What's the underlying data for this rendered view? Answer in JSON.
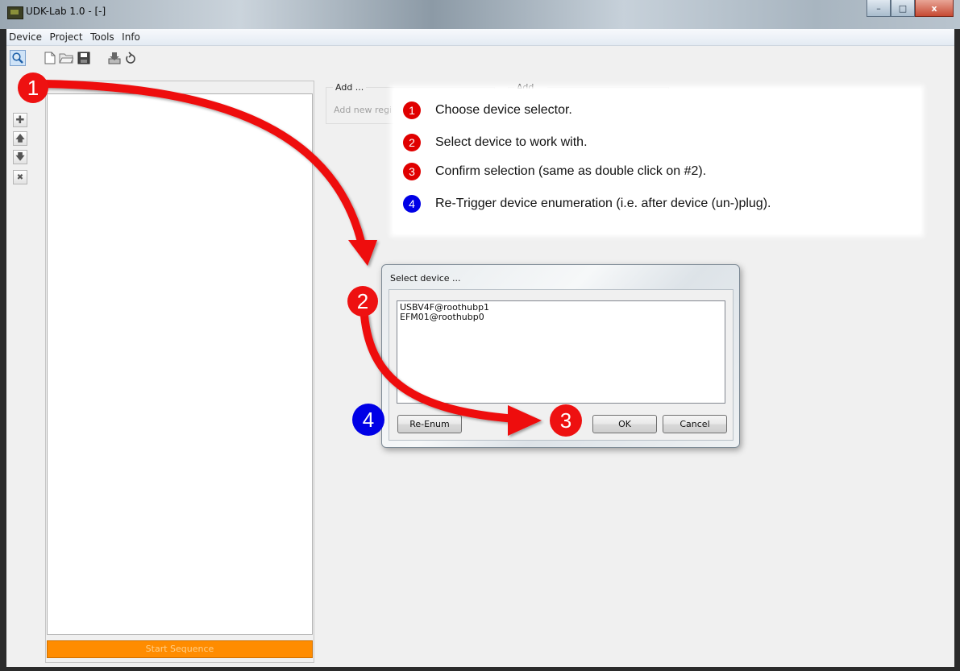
{
  "window": {
    "title": "UDK-Lab 1.0 - [-]",
    "minimize": "–",
    "maximize": "□",
    "close": "x"
  },
  "menu": [
    "Device",
    "Project",
    "Tools",
    "Info"
  ],
  "toolbar_icons": [
    "search-icon",
    "new-file-icon",
    "open-folder-icon",
    "save-icon",
    "download-icon",
    "refresh-icon"
  ],
  "side_buttons": [
    {
      "name": "add-step-button",
      "glyph": "✚"
    },
    {
      "name": "move-up-button",
      "glyph": "🡅"
    },
    {
      "name": "move-down-button",
      "glyph": "🡇"
    },
    {
      "name": "remove-step-button",
      "glyph": "✖"
    }
  ],
  "sequence": {
    "start_label": "Start Sequence"
  },
  "groups": {
    "add1_title": "Add ...",
    "add1_hint": "Add new regi",
    "add2_title": "Add ..."
  },
  "legend": [
    {
      "num": "1",
      "text": "Choose device selector.",
      "color": "#e00000"
    },
    {
      "num": "2",
      "text": "Select device to work with.",
      "color": "#e00000"
    },
    {
      "num": "3",
      "text": "Confirm selection (same as double click on #2).",
      "color": "#e00000"
    },
    {
      "num": "4",
      "text": "Re-Trigger device enumeration (i.e. after device (un-)plug).",
      "color": "#0000e6"
    }
  ],
  "dialog": {
    "title": "Select device ...",
    "devices": [
      "USBV4F@roothubp1",
      "EFM01@roothubp0"
    ],
    "reenum_label": "Re-Enum",
    "ok_label": "OK",
    "cancel_label": "Cancel"
  },
  "markers": {
    "m1": "1",
    "m2": "2",
    "m3": "3",
    "m4": "4"
  },
  "colors": {
    "annotation_red": "#e00000",
    "annotation_blue": "#0000e6",
    "start_button": "#ff8c00"
  }
}
